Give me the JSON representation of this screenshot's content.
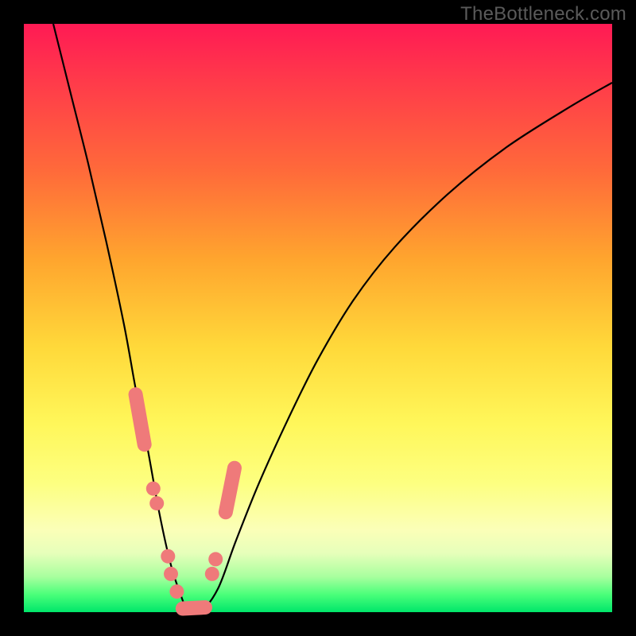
{
  "watermark": "TheBottleneck.com",
  "colors": {
    "page_bg": "#000000",
    "curve_stroke": "#000000",
    "marker_fill": "#ef7a7a",
    "marker_stroke": "#c96060"
  },
  "chart_data": {
    "type": "line",
    "title": "",
    "xlabel": "",
    "ylabel": "",
    "xlim": [
      0,
      100
    ],
    "ylim": [
      0,
      100
    ],
    "grid": false,
    "legend": false,
    "note": "Axes are implicit percentages; the curve plots bottleneck mismatch (y, 0 = ideal) against a relative component position (x). Values estimated from pixel positions.",
    "series": [
      {
        "name": "bottleneck-curve",
        "kind": "line",
        "x": [
          5,
          8,
          11,
          14,
          17,
          19,
          21,
          23,
          25,
          27,
          28,
          30,
          33,
          36,
          40,
          45,
          50,
          56,
          63,
          72,
          82,
          93,
          100
        ],
        "y": [
          100,
          88,
          76,
          63,
          49,
          38,
          28,
          17,
          8,
          2,
          0,
          0,
          4,
          12,
          22,
          33,
          43,
          53,
          62,
          71,
          79,
          86,
          90
        ]
      },
      {
        "name": "highlighted-points",
        "kind": "scatter",
        "x": [
          19.0,
          19.7,
          20.5,
          22.0,
          22.6,
          24.5,
          25.0,
          26.0,
          27.5,
          28.3,
          29.0,
          30.5,
          32.0,
          32.6,
          34.5,
          35.0,
          35.7
        ],
        "y": [
          37.0,
          33.0,
          28.5,
          21.0,
          18.5,
          9.5,
          6.5,
          3.5,
          0.5,
          0.3,
          0.3,
          1.5,
          6.5,
          9.0,
          17.5,
          20.5,
          24.0
        ]
      }
    ]
  }
}
